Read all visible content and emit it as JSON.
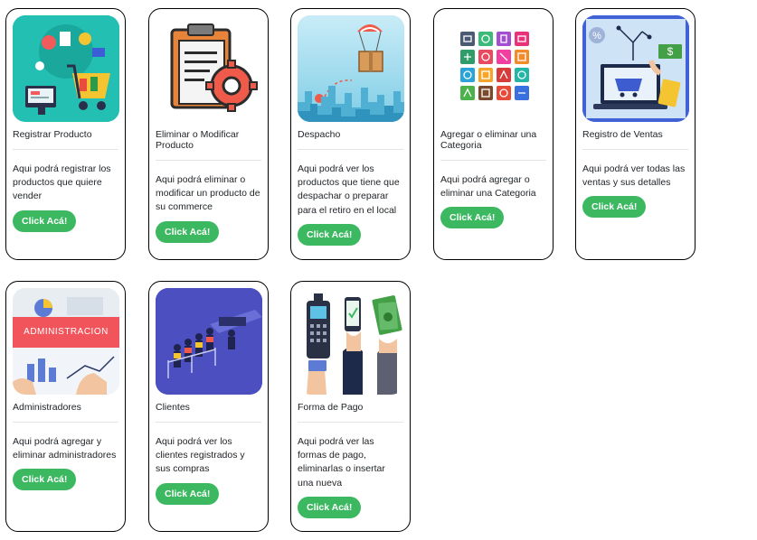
{
  "button_label": "Click Acá!",
  "cards": [
    {
      "icon": "shopping-register-icon",
      "title": "Registrar Producto",
      "description": "Aqui podrá registrar los productos que quiere vender"
    },
    {
      "icon": "clipboard-gear-icon",
      "title": "Eliminar o Modificar Producto",
      "description": "Aqui podrá eliminar o modificar un producto de su commerce"
    },
    {
      "icon": "parachute-package-icon",
      "title": "Despacho",
      "description": "Aqui podrá ver los productos que tiene que despachar o preparar para el retiro en el local"
    },
    {
      "icon": "category-grid-icon",
      "title": "Agregar o eliminar una Categoria",
      "description": "Aqui podrá agregar o eliminar una Categoria"
    },
    {
      "icon": "sales-laptop-icon",
      "title": "Registro de Ventas",
      "description": "Aqui podrá ver todas las ventas y sus detalles"
    },
    {
      "icon": "administration-banner-icon",
      "banner_text": "ADMINISTRACION",
      "title": "Administradores",
      "description": "Aqui podrá agregar y eliminar administradores"
    },
    {
      "icon": "customers-queue-icon",
      "title": "Clientes",
      "description": "Aqui podrá ver los clientes registrados y sus compras"
    },
    {
      "icon": "payment-methods-icon",
      "title": "Forma de Pago",
      "description": "Aqui podrá ver las formas de pago, eliminarlas o insertar una nueva"
    }
  ]
}
